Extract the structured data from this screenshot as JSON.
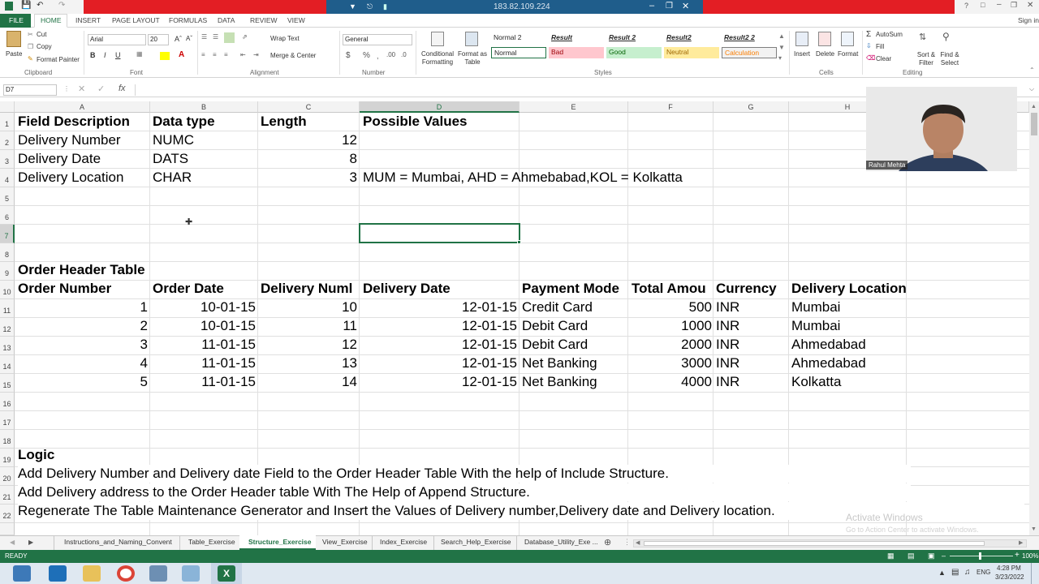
{
  "remote": {
    "ip": "183.82.109.224"
  },
  "titlebar": {
    "help": "?",
    "signin": "Sign in"
  },
  "ribbon_tabs": [
    "FILE",
    "HOME",
    "INSERT",
    "PAGE LAYOUT",
    "FORMULAS",
    "DATA",
    "REVIEW",
    "VIEW"
  ],
  "clipboard": {
    "paste": "Paste",
    "cut": "Cut",
    "copy": "Copy",
    "format_painter": "Format Painter",
    "label": "Clipboard"
  },
  "font": {
    "name": "Arial",
    "size": "20",
    "bold": "B",
    "italic": "I",
    "underline": "U",
    "label": "Font"
  },
  "alignment": {
    "wrap": "Wrap Text",
    "merge": "Merge & Center",
    "label": "Alignment"
  },
  "number": {
    "format": "General",
    "label": "Number"
  },
  "styles": {
    "conditional": "Conditional Formatting",
    "format_as_table": "Format as Table",
    "cells": [
      {
        "text": "Normal 2",
        "fg": "#000000",
        "bg": "#ffffff"
      },
      {
        "text": "Result",
        "fg": "#000000",
        "bg": "#ffffff"
      },
      {
        "text": "Result 2",
        "fg": "#000000",
        "bg": "#ffffff"
      },
      {
        "text": "Result2",
        "fg": "#000000",
        "bg": "#ffffff"
      },
      {
        "text": "Result2 2",
        "fg": "#000000",
        "bg": "#ffffff"
      },
      {
        "text": "Normal",
        "fg": "#000000",
        "bg": "#ffffff"
      },
      {
        "text": "Bad",
        "fg": "#9c0006",
        "bg": "#ffc7ce"
      },
      {
        "text": "Good",
        "fg": "#006100",
        "bg": "#c6efce"
      },
      {
        "text": "Neutral",
        "fg": "#9c6500",
        "bg": "#ffeb9c"
      },
      {
        "text": "Calculation",
        "fg": "#fa7d00",
        "bg": "#f2f2f2"
      }
    ],
    "label": "Styles"
  },
  "cells_group": {
    "insert": "Insert",
    "delete": "Delete",
    "format": "Format",
    "label": "Cells"
  },
  "editing": {
    "autosum": "AutoSum",
    "fill": "Fill",
    "clear": "Clear",
    "sort": "Sort & Filter",
    "find": "Find & Select",
    "label": "Editing"
  },
  "formula_bar": {
    "name_box": "D7",
    "fx": "fx",
    "value": ""
  },
  "columns": [
    "A",
    "B",
    "C",
    "D",
    "E",
    "F",
    "G",
    "H"
  ],
  "rows": [
    "1",
    "2",
    "3",
    "4",
    "5",
    "6",
    "7",
    "8",
    "9",
    "10",
    "11",
    "12",
    "13",
    "14",
    "15",
    "16",
    "17",
    "18",
    "19",
    "20",
    "21",
    "22"
  ],
  "sheet": {
    "field_headers": [
      "Field Description",
      "Data type",
      "Length",
      "Possible Values"
    ],
    "fields": [
      {
        "desc": "Delivery Number",
        "type": "NUMC",
        "len": "12",
        "values": ""
      },
      {
        "desc": "Delivery Date",
        "type": "DATS",
        "len": "8",
        "values": ""
      },
      {
        "desc": "Delivery Location",
        "type": "CHAR",
        "len": "3",
        "values": "MUM = Mumbai, AHD = Ahmebabad,KOL = Kolkatta"
      }
    ],
    "order_title": "Order Header Table",
    "order_headers": [
      "Order Number",
      "Order Date",
      "Delivery Numl",
      "Delivery Date",
      "Payment Mode",
      "Total Amou",
      "Currency",
      "Delivery Location"
    ],
    "orders": [
      [
        "1",
        "10-01-15",
        "10",
        "12-01-15",
        "Credit Card",
        "500",
        "INR",
        "Mumbai"
      ],
      [
        "2",
        "10-01-15",
        "11",
        "12-01-15",
        "Debit Card",
        "1000",
        "INR",
        "Mumbai"
      ],
      [
        "3",
        "11-01-15",
        "12",
        "12-01-15",
        "Debit Card",
        "2000",
        "INR",
        "Ahmedabad"
      ],
      [
        "4",
        "11-01-15",
        "13",
        "12-01-15",
        "Net Banking",
        "3000",
        "INR",
        "Ahmedabad"
      ],
      [
        "5",
        "11-01-15",
        "14",
        "12-01-15",
        "Net Banking",
        "4000",
        "INR",
        "Kolkatta"
      ]
    ],
    "logic_title": "Logic",
    "logic_lines": [
      "Add Delivery Number and Delivery date Field to the Order Header Table With the help of Include Structure.",
      "Add Delivery address to the Order Header table With The Help of Append Structure.",
      "Regenerate The Table Maintenance Generator and Insert the Values of Delivery number,Delivery date  and Delivery location."
    ]
  },
  "sheet_tabs": [
    "Instructions_and_Naming_Convent",
    "Table_Exercise",
    "Structure_Exercise",
    "View_Exercise",
    "Index_Exercise",
    "Search_Help_Exercise",
    "Database_Utility_Exe ..."
  ],
  "active_sheet": "Structure_Exercise",
  "status": {
    "ready": "READY",
    "zoom": "100%"
  },
  "watermark": {
    "line1": "Activate Windows",
    "line2": "Go to Action Center to activate Windows."
  },
  "webcam": {
    "name": "Rahul Mehta"
  },
  "taskbar": {
    "lang": "ENG",
    "time": "4:28 PM",
    "date": "3/23/2022"
  },
  "colors": {
    "excel_green": "#217346",
    "remote_red": "#e31e24",
    "remote_blue": "#1f5d8b"
  }
}
